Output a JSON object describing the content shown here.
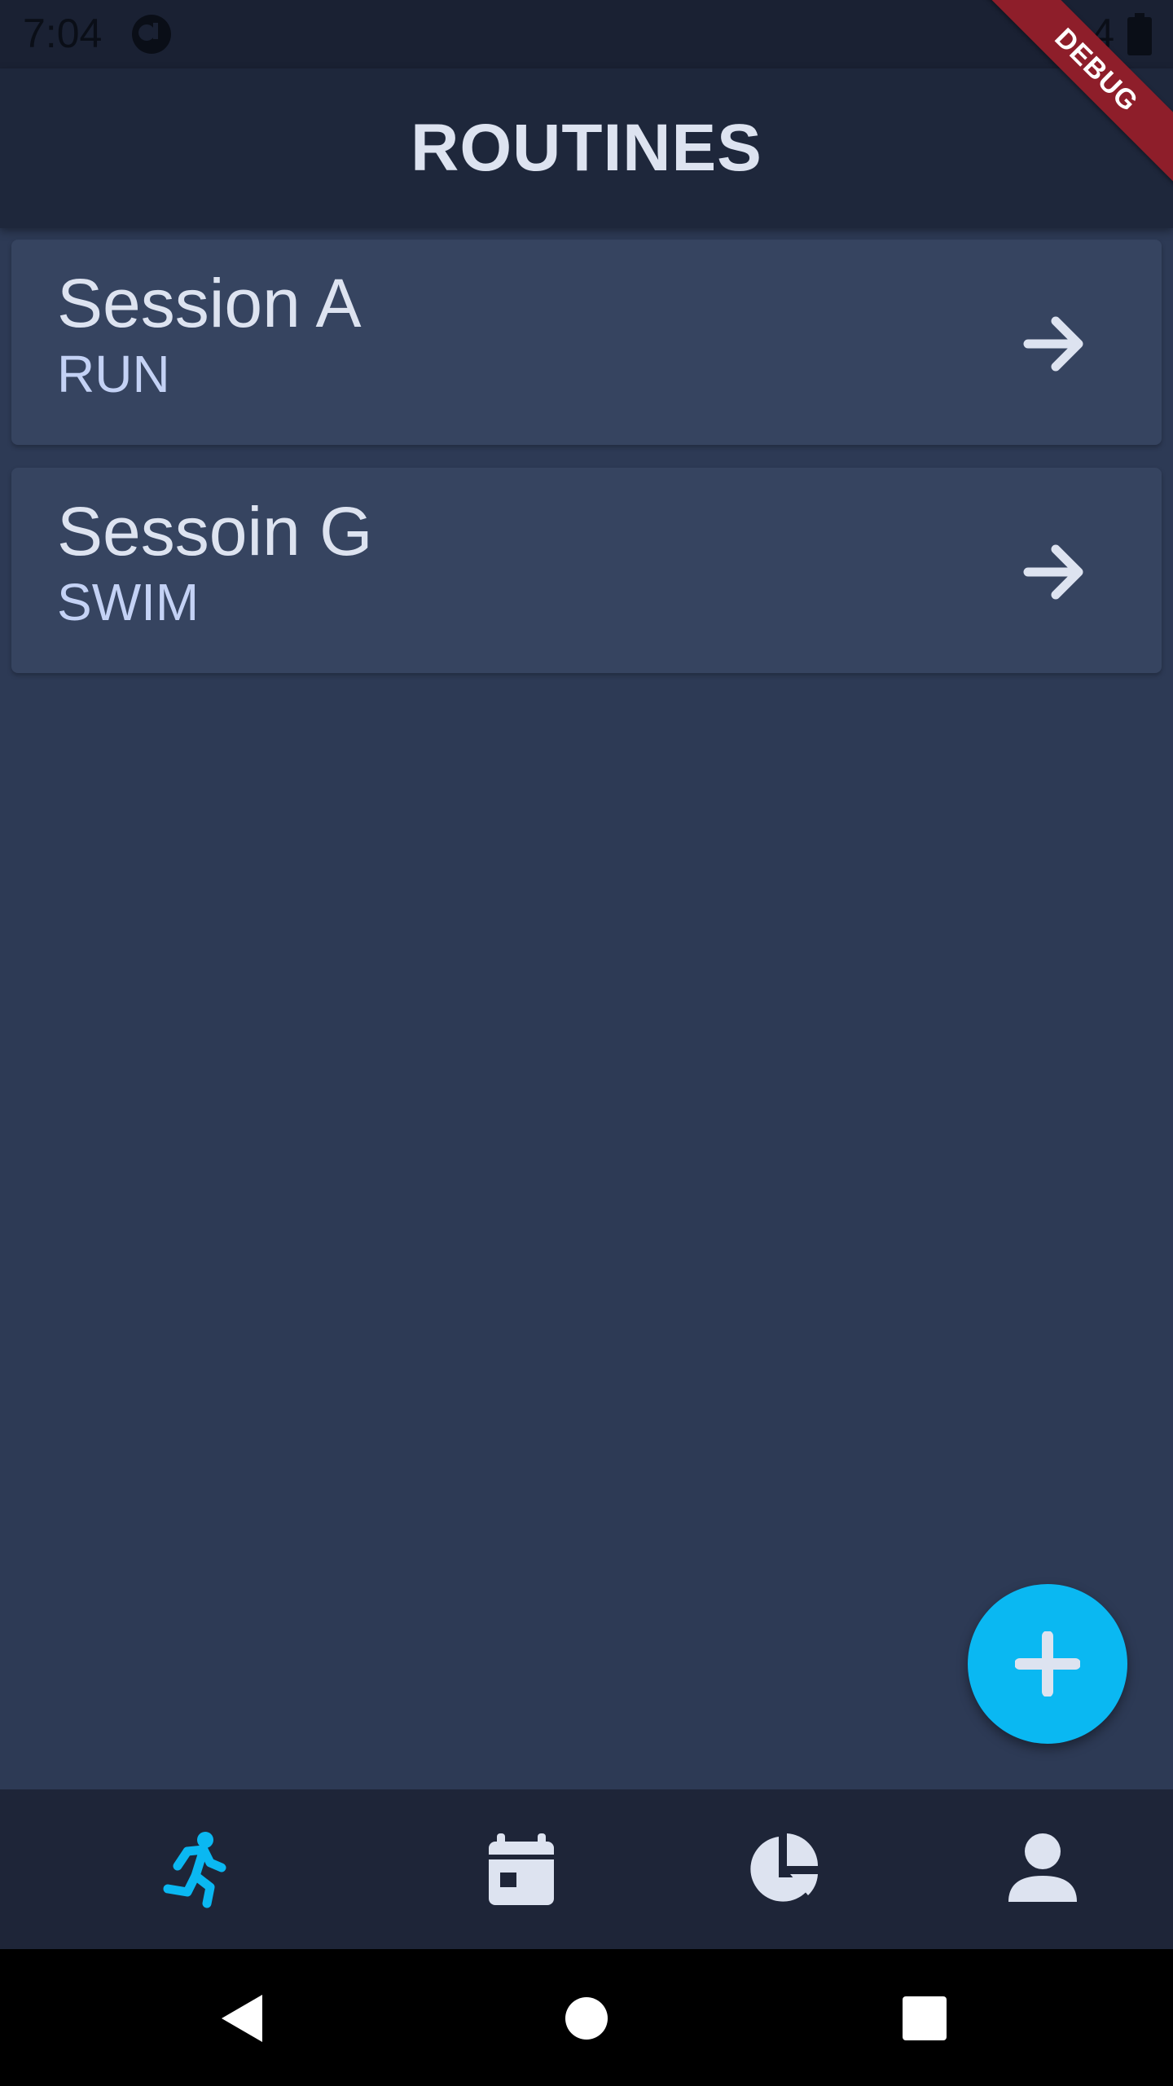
{
  "status_bar": {
    "time": "7:04",
    "signal_digit": "4",
    "icons": [
      "app-notification-icon",
      "wifi-icon",
      "battery-icon"
    ]
  },
  "debug_banner": {
    "label": "DEBUG"
  },
  "app_bar": {
    "title": "ROUTINES"
  },
  "routines": [
    {
      "title": "Session A",
      "subtitle": "RUN",
      "icon": "arrow-right-icon"
    },
    {
      "title": "Sessoin G",
      "subtitle": "SWIM",
      "icon": "arrow-right-icon"
    }
  ],
  "fab": {
    "icon": "plus-icon"
  },
  "bottom_nav": {
    "items": [
      {
        "icon": "running-icon",
        "active": true
      },
      {
        "icon": "calendar-icon",
        "active": false
      },
      {
        "icon": "pie-chart-icon",
        "active": false
      },
      {
        "icon": "profile-icon",
        "active": false
      }
    ]
  },
  "system_nav": {
    "icons": [
      "back-icon",
      "home-icon",
      "recents-icon"
    ]
  },
  "colors": {
    "background": "#2d3a55",
    "app_bar": "#1e273b",
    "card": "#364460",
    "accent": "#0ab8f2",
    "text_primary": "#dde3f0",
    "text_secondary": "#c4d2f5",
    "debug_ribbon": "#8e1e2a"
  }
}
